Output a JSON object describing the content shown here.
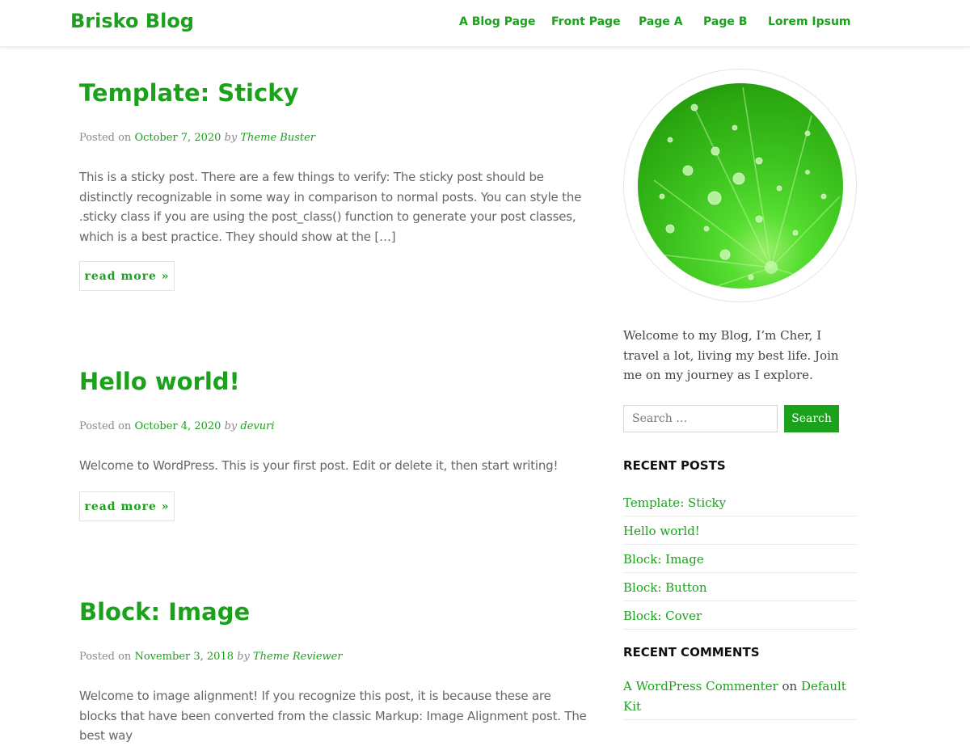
{
  "header": {
    "site_title": "Brisko Blog",
    "nav": [
      "A Blog Page",
      "Front Page",
      "Page A",
      "Page B",
      "Lorem Ipsum"
    ]
  },
  "posts": [
    {
      "title": "Template: Sticky",
      "posted_on": "Posted on",
      "date": "October 7, 2020",
      "by": "by",
      "author": "Theme Buster",
      "excerpt": "This is a sticky post. There are a few things to verify: The sticky post should be distinctly recognizable in some way in comparison to normal posts. You can style the .sticky class if you are using the post_class() function to generate your post classes, which is a best practice. They should show at the […]",
      "read_more": "read more »"
    },
    {
      "title": "Hello world!",
      "posted_on": "Posted on",
      "date": "October 4, 2020",
      "by": "by",
      "author": "devuri",
      "excerpt": "Welcome to WordPress. This is your first post. Edit or delete it, then start writing!",
      "read_more": "read more »"
    },
    {
      "title": "Block: Image",
      "posted_on": "Posted on",
      "date": "November 3, 2018",
      "by": "by",
      "author": "Theme Reviewer",
      "excerpt": "Welcome to image alignment! If you recognize this post, it is because these are blocks that have been converted from the classic Markup: Image Alignment post. The best way"
    }
  ],
  "sidebar": {
    "intro": "Welcome to my Blog, I’m Cher, I travel a lot, living my best life. Join me on my journey as I explore.",
    "search": {
      "placeholder": "Search …",
      "button": "Search"
    },
    "recent_posts_title": "RECENT POSTS",
    "recent_posts": [
      "Template: Sticky",
      "Hello world!",
      "Block: Image",
      "Block: Button",
      "Block: Cover"
    ],
    "recent_comments_title": "RECENT COMMENTS",
    "recent_comment": {
      "author": "A WordPress Commenter",
      "on": "on",
      "post": "Default Kit"
    }
  },
  "colors": {
    "accent": "#1ba11b",
    "text": "#666666",
    "meta": "#888888",
    "widget_title": "#111111"
  },
  "icons": {
    "avatar": "green-leaf-with-water-drops-photo"
  }
}
